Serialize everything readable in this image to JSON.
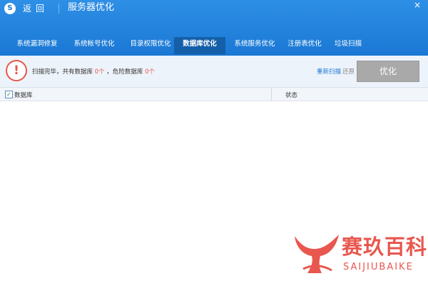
{
  "titlebar": {
    "back_label": "返回",
    "title": "服务器优化",
    "close": "×"
  },
  "tabs": [
    {
      "label": "系统漏洞修复",
      "active": false
    },
    {
      "label": "系统帐号优化",
      "active": false
    },
    {
      "label": "目录权限优化",
      "active": false
    },
    {
      "label": "数据库优化",
      "active": true
    },
    {
      "label": "系统服务优化",
      "active": false
    },
    {
      "label": "注册表优化",
      "active": false
    },
    {
      "label": "垃圾扫描",
      "active": false
    }
  ],
  "status": {
    "alert_symbol": "!",
    "prefix": "扫描完毕，共有数据库",
    "db_count": "0个",
    "middle": "，危险数据库",
    "danger_count": "0个",
    "rescan_label": "重新扫描",
    "restore_label": "还原",
    "optimize_label": "优化"
  },
  "table": {
    "col_database": "数据库",
    "col_status": "状态",
    "check_all": "✓"
  },
  "watermark": {
    "cn": "赛玖百科",
    "en": "SAIJIUBAIKE"
  },
  "colors": {
    "titlebar": "#1a78d4",
    "active_tab": "#145fa8",
    "alert": "#e8574e",
    "link": "#1a78d4",
    "button_disabled": "#a9a9a9"
  }
}
